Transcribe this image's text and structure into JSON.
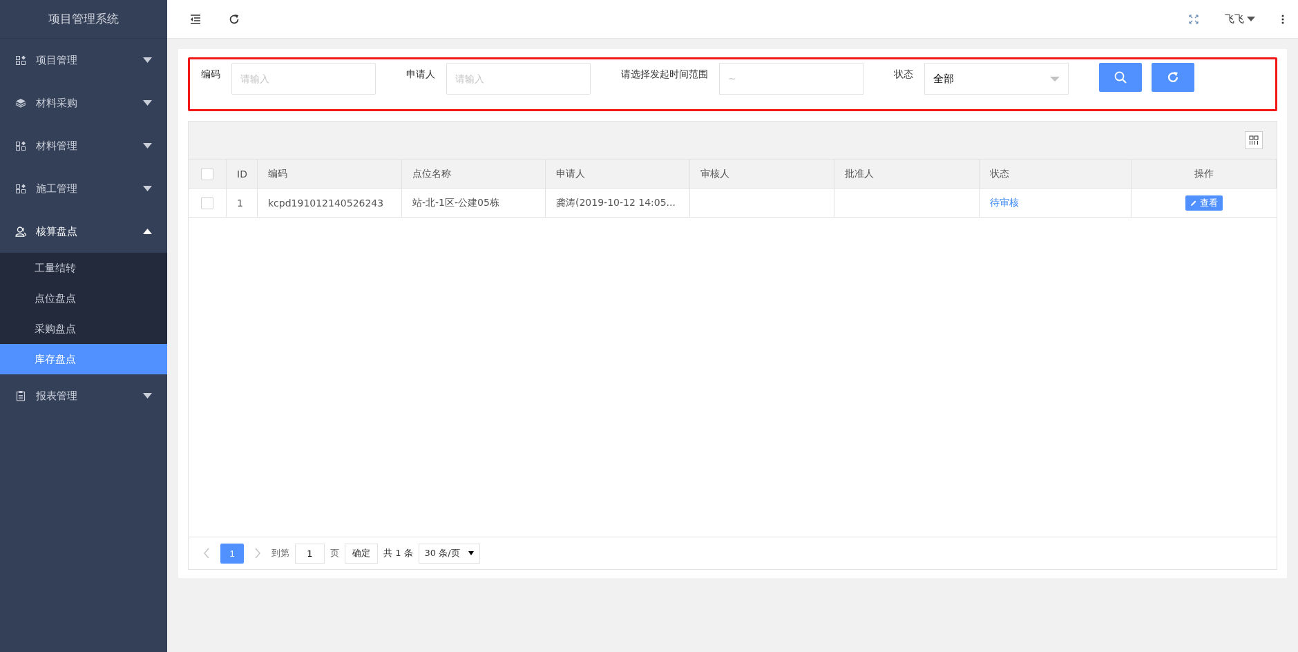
{
  "sidebar": {
    "title": "项目管理系统",
    "items": [
      {
        "label": "项目管理",
        "kind": "module",
        "expanded": false
      },
      {
        "label": "材料采购",
        "kind": "stack",
        "expanded": false
      },
      {
        "label": "材料管理",
        "kind": "module",
        "expanded": false
      },
      {
        "label": "施工管理",
        "kind": "module",
        "expanded": false
      },
      {
        "label": "核算盘点",
        "kind": "person",
        "expanded": true,
        "children": [
          {
            "label": "工量结转",
            "selected": false
          },
          {
            "label": "点位盘点",
            "selected": false
          },
          {
            "label": "采购盘点",
            "selected": false
          },
          {
            "label": "库存盘点",
            "selected": true
          }
        ]
      },
      {
        "label": "报表管理",
        "kind": "report",
        "expanded": false
      }
    ]
  },
  "topbar": {
    "user": "飞飞"
  },
  "filters": [
    {
      "kind": "text",
      "label": "编码",
      "placeholder": "请输入"
    },
    {
      "kind": "text",
      "label": "申请人",
      "placeholder": "请输入"
    },
    {
      "kind": "range",
      "label": "请选择发起时间范围",
      "separator": "~"
    },
    {
      "kind": "select",
      "label": "状态",
      "value": "全部"
    }
  ],
  "table": {
    "header_checked": false,
    "columns": [
      "ID",
      "编码",
      "点位名称",
      "申请人",
      "审核人",
      "批准人",
      "状态",
      "操作"
    ],
    "rows": [
      {
        "checked": false,
        "id": "1",
        "code": "kcpd191012140526243",
        "site": "站-北-1区-公建05栋",
        "applicant": "龚涛(2019-10-12 14:05...",
        "status": "待审核",
        "action": "查看"
      }
    ]
  },
  "pagination": {
    "current": "1",
    "goto": "到第",
    "page_input": "1",
    "page_unit": "页",
    "confirm": "确定",
    "total": "共 1 条",
    "page_size": "30 条/页"
  }
}
